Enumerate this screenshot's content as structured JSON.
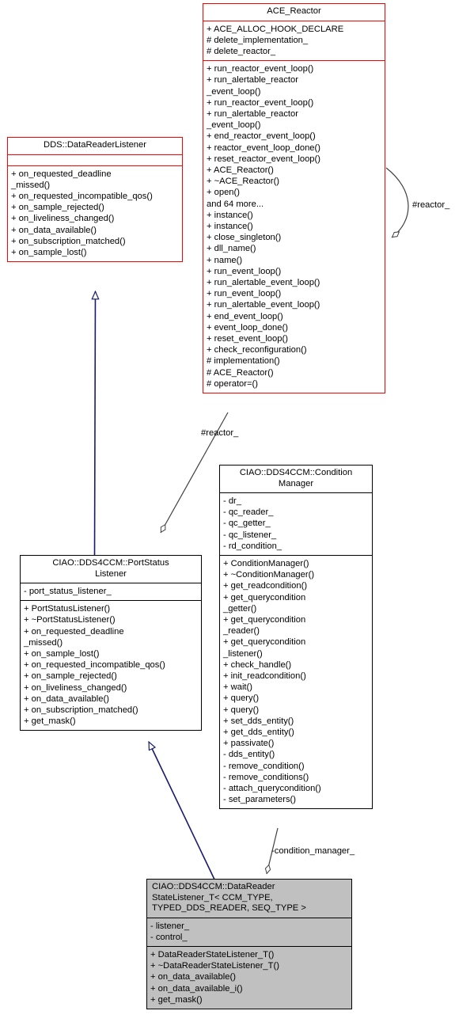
{
  "diagram": {
    "kind": "uml-class-diagram",
    "colors": {
      "interface_border": "#ff0000",
      "class_border": "#000000",
      "inheritance_edge": "#191970",
      "association_edge": "#404040",
      "highlight_fill": "#c0c0c0",
      "background": "#ffffff"
    }
  },
  "classes": {
    "ace_reactor": {
      "name": "ACE_Reactor",
      "attributes": [
        "+ ACE_ALLOC_HOOK_DECLARE",
        "# delete_implementation_",
        "# delete_reactor_"
      ],
      "operations": [
        "+ run_reactor_event_loop()",
        "+ run_alertable_reactor\n_event_loop()",
        "+ run_reactor_event_loop()",
        "+ run_alertable_reactor\n_event_loop()",
        "+ end_reactor_event_loop()",
        "+ reactor_event_loop_done()",
        "+ reset_reactor_event_loop()",
        "+ ACE_Reactor()",
        "+ ~ACE_Reactor()",
        "+ open()",
        "and 64 more...",
        "+ instance()",
        "+ instance()",
        "+ close_singleton()",
        "+ dll_name()",
        "+ name()",
        "+ run_event_loop()",
        "+ run_alertable_event_loop()",
        "+ run_event_loop()",
        "+ run_alertable_event_loop()",
        "+ end_event_loop()",
        "+ event_loop_done()",
        "+ reset_event_loop()",
        "+ check_reconfiguration()",
        "# implementation()",
        "# ACE_Reactor()",
        "# operator=()"
      ]
    },
    "datareaderlistener": {
      "name": "DDS::DataReaderListener",
      "attributes": [],
      "operations": [
        "+ on_requested_deadline\n_missed()",
        "+ on_requested_incompatible_qos()",
        "+ on_sample_rejected()",
        "+ on_liveliness_changed()",
        "+ on_data_available()",
        "+ on_subscription_matched()",
        "+ on_sample_lost()"
      ]
    },
    "portstatuslistener": {
      "name": "CIAO::DDS4CCM::PortStatus\nListener",
      "attributes": [
        "- port_status_listener_"
      ],
      "operations": [
        "+ PortStatusListener()",
        "+ ~PortStatusListener()",
        "+ on_requested_deadline\n_missed()",
        "+ on_sample_lost()",
        "+ on_requested_incompatible_qos()",
        "+ on_sample_rejected()",
        "+ on_liveliness_changed()",
        "+ on_data_available()",
        "+ on_subscription_matched()",
        "+ get_mask()"
      ]
    },
    "conditionmanager": {
      "name": "CIAO::DDS4CCM::Condition\nManager",
      "attributes": [
        "- dr_",
        "- qc_reader_",
        "- qc_getter_",
        "- qc_listener_",
        "- rd_condition_"
      ],
      "operations": [
        "+ ConditionManager()",
        "+ ~ConditionManager()",
        "+ get_readcondition()",
        "+ get_querycondition\n_getter()",
        "+ get_querycondition\n_reader()",
        "+ get_querycondition\n_listener()",
        "+ check_handle()",
        "+ init_readcondition()",
        "+ wait()",
        "+ query()",
        "+ query()",
        "+ set_dds_entity()",
        "+ get_dds_entity()",
        "+ passivate()",
        "- dds_entity()",
        "- remove_condition()",
        "- remove_conditions()",
        "- attach_querycondition()",
        "- set_parameters()"
      ]
    },
    "datareaderstatelistener": {
      "name": "CIAO::DDS4CCM::DataReader\nStateListener_T< CCM_TYPE,\n TYPED_DDS_READER, SEQ_TYPE >",
      "attributes": [
        "- listener_",
        "- control_"
      ],
      "operations": [
        "+ DataReaderStateListener_T()",
        "+ ~DataReaderStateListener_T()",
        "+ on_data_available()",
        "+ on_data_available_i()",
        "+ get_mask()"
      ]
    }
  },
  "edge_labels": {
    "reactor_self": "#reactor_",
    "reactor_port": "#reactor_",
    "condition_manager": "-condition_manager_"
  }
}
